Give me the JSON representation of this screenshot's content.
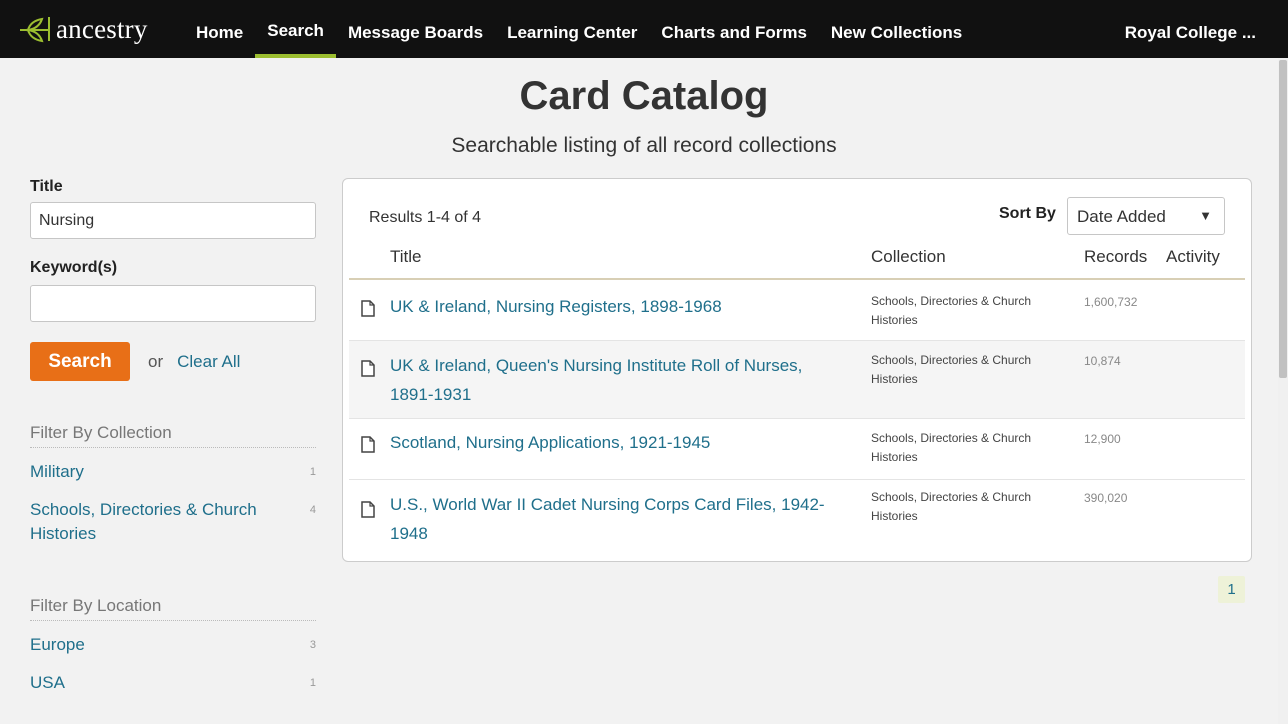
{
  "nav": {
    "logo_text": "ancestry",
    "items": [
      {
        "label": "Home"
      },
      {
        "label": "Search",
        "active": true
      },
      {
        "label": "Message Boards"
      },
      {
        "label": "Learning Center"
      },
      {
        "label": "Charts and Forms"
      },
      {
        "label": "New Collections"
      }
    ],
    "account_label": "Royal College ...",
    "accent_color": "#9cbe30"
  },
  "header": {
    "title": "Card Catalog",
    "subtitle": "Searchable listing of all record collections"
  },
  "sidebar": {
    "title_label": "Title",
    "title_value": "Nursing",
    "keyword_label": "Keyword(s)",
    "keyword_value": "",
    "search_button": "Search",
    "or_text": "or",
    "clear_link": "Clear All",
    "collection_filter": {
      "heading": "Filter By Collection",
      "items": [
        {
          "label": "Military",
          "count": "1"
        },
        {
          "label": "Schools, Directories & Church Histories",
          "count": "4"
        }
      ]
    },
    "location_filter": {
      "heading": "Filter By Location",
      "items": [
        {
          "label": "Europe",
          "count": "3"
        },
        {
          "label": "USA",
          "count": "1"
        }
      ]
    }
  },
  "results": {
    "count_text": "Results 1-4 of 4",
    "sort_label": "Sort By",
    "sort_value": "Date Added",
    "columns": {
      "title": "Title",
      "collection": "Collection",
      "records": "Records",
      "activity": "Activity"
    },
    "rows": [
      {
        "title": "UK & Ireland, Nursing Registers, 1898-1968",
        "collection": "Schools, Directories & Church Histories",
        "records": "1,600,732"
      },
      {
        "title": "UK & Ireland, Queen's Nursing Institute Roll of Nurses, 1891-1931",
        "collection": "Schools, Directories & Church Histories",
        "records": "10,874"
      },
      {
        "title": "Scotland, Nursing Applications, 1921-1945",
        "collection": "Schools, Directories & Church Histories",
        "records": "12,900"
      },
      {
        "title": "U.S., World War II Cadet Nursing Corps Card Files, 1942-1948",
        "collection": "Schools, Directories & Church Histories",
        "records": "390,020"
      }
    ],
    "page_number": "1",
    "icon": "document-icon"
  },
  "colors": {
    "link": "#1f6f8b",
    "button": "#e86f17",
    "nav_background": "#111111",
    "page_background": "#f2f2f2"
  }
}
